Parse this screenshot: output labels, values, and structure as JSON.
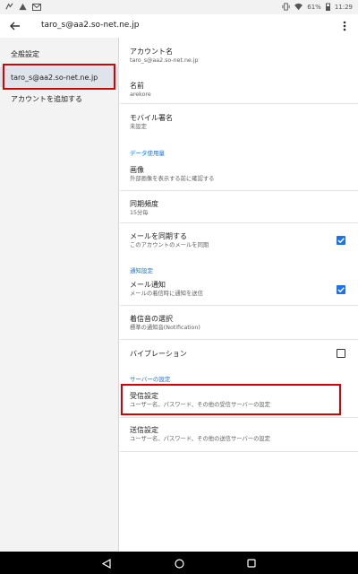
{
  "status_bar": {
    "battery_percent": "61%",
    "time": "11:29"
  },
  "app_bar": {
    "title": "taro_s@aa2.so-net.ne.jp"
  },
  "sidebar": {
    "general_settings": "全般設定",
    "account": "taro_s@aa2.so-net.ne.jp",
    "add_account": "アカウントを追加する"
  },
  "settings": {
    "account_name": {
      "title": "アカウント名",
      "value": "taro_s@aa2.so-net.ne.jp"
    },
    "name": {
      "title": "名前",
      "value": "arekore"
    },
    "mobile_signature": {
      "title": "モバイル署名",
      "value": "未設定"
    },
    "data_usage_section": "データ使用量",
    "images": {
      "title": "画像",
      "value": "外部画像を表示する前に確認する"
    },
    "sync_frequency": {
      "title": "同期頻度",
      "value": "15分毎"
    },
    "sync_mail": {
      "title": "メールを同期する",
      "value": "このアカウントのメールを同期",
      "checked": true
    },
    "notification_section": "通知設定",
    "mail_notification": {
      "title": "メール通知",
      "value": "メールの着信時に通知を送信",
      "checked": true
    },
    "ringtone": {
      "title": "着信音の選択",
      "value": "標準の通知音(Notification)"
    },
    "vibration": {
      "title": "バイブレーション",
      "checked": false
    },
    "server_section": "サーバーの設定",
    "incoming": {
      "title": "受信設定",
      "value": "ユーザー名、パスワード、その他の受信サーバーの設定"
    },
    "outgoing": {
      "title": "送信設定",
      "value": "ユーザー名、パスワード、その他の送信サーバーの設定"
    }
  },
  "colors": {
    "accent": "#1a73e8",
    "highlight_frame": "#d60000"
  }
}
